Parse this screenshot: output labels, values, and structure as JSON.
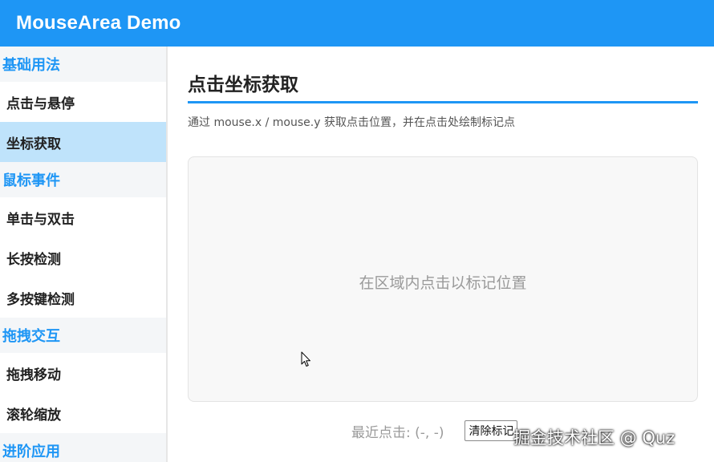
{
  "header": {
    "title": "MouseArea Demo"
  },
  "sidebar": {
    "groups": [
      {
        "label": "基础用法",
        "items": [
          {
            "label": "点击与悬停",
            "active": false
          },
          {
            "label": "坐标获取",
            "active": true
          }
        ]
      },
      {
        "label": "鼠标事件",
        "items": [
          {
            "label": "单击与双击",
            "active": false
          },
          {
            "label": "长按检测",
            "active": false
          },
          {
            "label": "多按键检测",
            "active": false
          }
        ]
      },
      {
        "label": "拖拽交互",
        "items": [
          {
            "label": "拖拽移动",
            "active": false
          },
          {
            "label": "滚轮缩放",
            "active": false
          }
        ]
      },
      {
        "label": "进阶应用",
        "items": []
      }
    ]
  },
  "main": {
    "title": "点击坐标获取",
    "subtitle": "通过 mouse.x / mouse.y 获取点击位置，并在点击处绘制标记点",
    "area_hint": "在区域内点击以标记位置",
    "last_click": "最近点击: (-, -)",
    "clear_button": "清除标记"
  },
  "watermark": "掘金技术社区 @ Quz",
  "colors": {
    "accent": "#1e96f5",
    "active_item_bg": "#bfe3fb",
    "group_bg": "#f4f6f8"
  }
}
